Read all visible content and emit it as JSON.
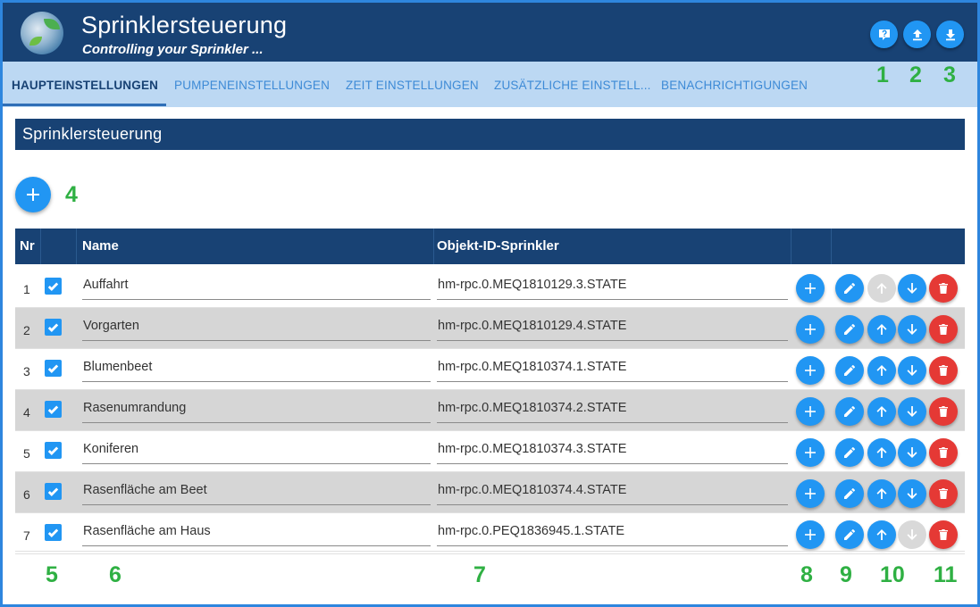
{
  "header": {
    "title": "Sprinklersteuerung",
    "subtitle": "Controlling your Sprinkler ...",
    "buttons": [
      {
        "icon": "help-icon"
      },
      {
        "icon": "upload-icon"
      },
      {
        "icon": "download-icon"
      }
    ]
  },
  "tabs": [
    {
      "label": "HAUPTEINSTELLUNGEN",
      "active": true
    },
    {
      "label": "PUMPENEINSTELLUNGEN",
      "active": false
    },
    {
      "label": "ZEIT EINSTELLUNGEN",
      "active": false
    },
    {
      "label": "ZUSÄTZLICHE EINSTELL...",
      "active": false
    },
    {
      "label": "BENACHRICHTIGUNGEN",
      "active": false
    }
  ],
  "section": {
    "title": "Sprinklersteuerung"
  },
  "table": {
    "columns": {
      "nr": "Nr",
      "name": "Name",
      "object_id": "Objekt-ID-Sprinkler"
    },
    "rows": [
      {
        "nr": "1",
        "enabled": true,
        "name": "Auffahrt",
        "object_id": "hm-rpc.0.MEQ1810129.3.STATE",
        "up_enabled": false,
        "down_enabled": true
      },
      {
        "nr": "2",
        "enabled": true,
        "name": "Vorgarten",
        "object_id": "hm-rpc.0.MEQ1810129.4.STATE",
        "up_enabled": true,
        "down_enabled": true
      },
      {
        "nr": "3",
        "enabled": true,
        "name": "Blumenbeet",
        "object_id": "hm-rpc.0.MEQ1810374.1.STATE",
        "up_enabled": true,
        "down_enabled": true
      },
      {
        "nr": "4",
        "enabled": true,
        "name": "Rasenumrandung",
        "object_id": "hm-rpc.0.MEQ1810374.2.STATE",
        "up_enabled": true,
        "down_enabled": true
      },
      {
        "nr": "5",
        "enabled": true,
        "name": "Koniferen",
        "object_id": "hm-rpc.0.MEQ1810374.3.STATE",
        "up_enabled": true,
        "down_enabled": true
      },
      {
        "nr": "6",
        "enabled": true,
        "name": "Rasenfläche am Beet",
        "object_id": "hm-rpc.0.MEQ1810374.4.STATE",
        "up_enabled": true,
        "down_enabled": true
      },
      {
        "nr": "7",
        "enabled": true,
        "name": "Rasenfläche am Haus",
        "object_id": "hm-rpc.0.PEQ1836945.1.STATE",
        "up_enabled": true,
        "down_enabled": false
      }
    ]
  },
  "annotations": {
    "a1": "1",
    "a2": "2",
    "a3": "3",
    "a4": "4",
    "a5": "5",
    "a6": "6",
    "a7": "7",
    "a8": "8",
    "a9": "9",
    "a10": "10",
    "a11": "11"
  },
  "colors": {
    "header": "#184274",
    "tabs_bg": "#bcd8f3",
    "accent": "#2196f3",
    "delete": "#e53935",
    "annotation": "#2fb043",
    "row_alt": "#d6d6d6"
  }
}
